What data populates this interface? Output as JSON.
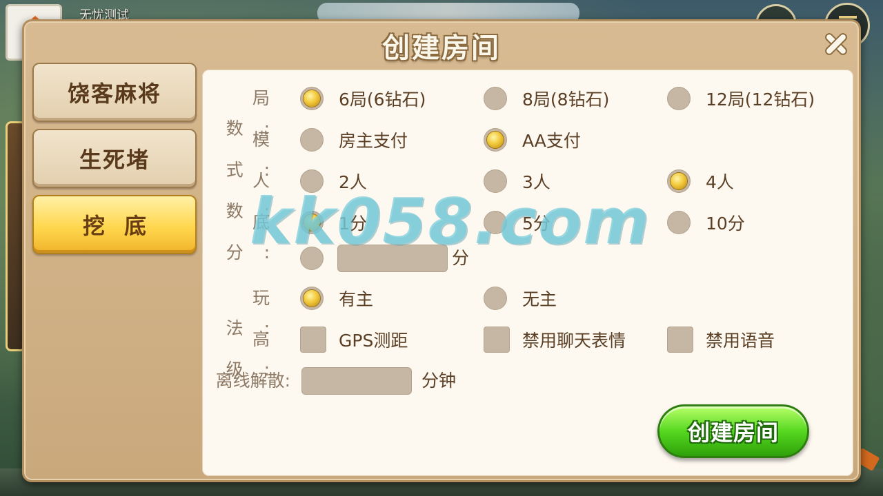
{
  "background": {
    "username": "无忧测试"
  },
  "dialog": {
    "title": "创建房间",
    "close_icon": "close-icon"
  },
  "game_tabs": [
    {
      "label": "饶客麻将",
      "active": false
    },
    {
      "label": "生死堵",
      "active": false
    },
    {
      "label": "挖底",
      "active": true
    }
  ],
  "rounds": {
    "label": "局数:",
    "options": [
      {
        "text": "6局(6钻石)",
        "checked": true
      },
      {
        "text": "8局(8钻石)",
        "checked": false
      },
      {
        "text": "12局(12钻石)",
        "checked": false
      }
    ]
  },
  "mode": {
    "label": "模式:",
    "options": [
      {
        "text": "房主支付",
        "checked": false
      },
      {
        "text": "AA支付",
        "checked": true
      }
    ]
  },
  "players": {
    "label": "人数:",
    "options": [
      {
        "text": "2人",
        "checked": false
      },
      {
        "text": "3人",
        "checked": false
      },
      {
        "text": "4人",
        "checked": true
      }
    ]
  },
  "base_score": {
    "label": "底分:",
    "options": [
      {
        "text": "1分",
        "checked": true
      },
      {
        "text": "5分",
        "checked": false
      },
      {
        "text": "10分",
        "checked": false
      }
    ],
    "custom_unit": "分",
    "custom_value": ""
  },
  "play_style": {
    "label": "玩法:",
    "options": [
      {
        "text": "有主",
        "checked": true
      },
      {
        "text": "无主",
        "checked": false
      }
    ]
  },
  "advanced": {
    "label": "高级:",
    "options": [
      {
        "text": "GPS测距",
        "checked": false
      },
      {
        "text": "禁用聊天表情",
        "checked": false
      },
      {
        "text": "禁用语音",
        "checked": false
      }
    ]
  },
  "offline_dismiss": {
    "label": "离线解散:",
    "unit": "分钟",
    "value": ""
  },
  "create_button": {
    "label": "创建房间"
  },
  "watermark": "kk058.com"
}
